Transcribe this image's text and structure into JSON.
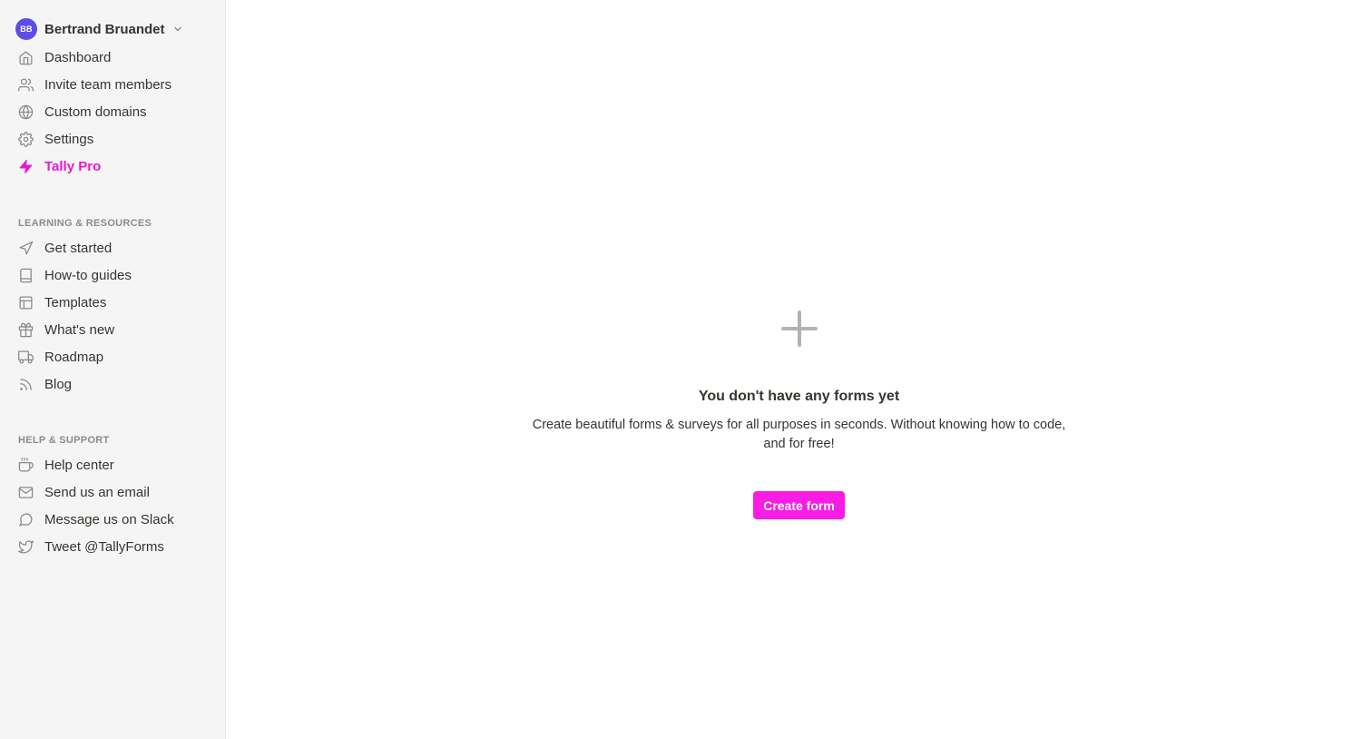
{
  "user": {
    "initials": "BB",
    "name": "Bertrand Bruandet"
  },
  "nav": [
    {
      "label": "Dashboard",
      "icon": "home-icon"
    },
    {
      "label": "Invite team members",
      "icon": "users-icon"
    },
    {
      "label": "Custom domains",
      "icon": "globe-icon"
    },
    {
      "label": "Settings",
      "icon": "gear-icon"
    },
    {
      "label": "Tally Pro",
      "icon": "lightning-icon"
    }
  ],
  "learning": {
    "title": "LEARNING & RESOURCES",
    "items": [
      {
        "label": "Get started",
        "icon": "send-icon"
      },
      {
        "label": "How-to guides",
        "icon": "book-icon"
      },
      {
        "label": "Templates",
        "icon": "layout-icon"
      },
      {
        "label": "What's new",
        "icon": "gift-icon"
      },
      {
        "label": "Roadmap",
        "icon": "truck-icon"
      },
      {
        "label": "Blog",
        "icon": "rss-icon"
      }
    ]
  },
  "help": {
    "title": "HELP & SUPPORT",
    "items": [
      {
        "label": "Help center",
        "icon": "coffee-icon"
      },
      {
        "label": "Send us an email",
        "icon": "mail-icon"
      },
      {
        "label": "Message us on Slack",
        "icon": "message-circle-icon"
      },
      {
        "label": "Tweet @TallyForms",
        "icon": "twitter-icon"
      }
    ]
  },
  "empty_state": {
    "icon": "plus-icon",
    "title": "You don't have any forms yet",
    "description": "Create beautiful forms & surveys for all purposes in seconds. Without knowing how to code, and for free!",
    "button_label": "Create form"
  },
  "colors": {
    "accent": "#f81ce5",
    "pro": "#e619d4",
    "avatar": "#5b4ee6",
    "sidebar_bg": "#f5f5f5"
  }
}
